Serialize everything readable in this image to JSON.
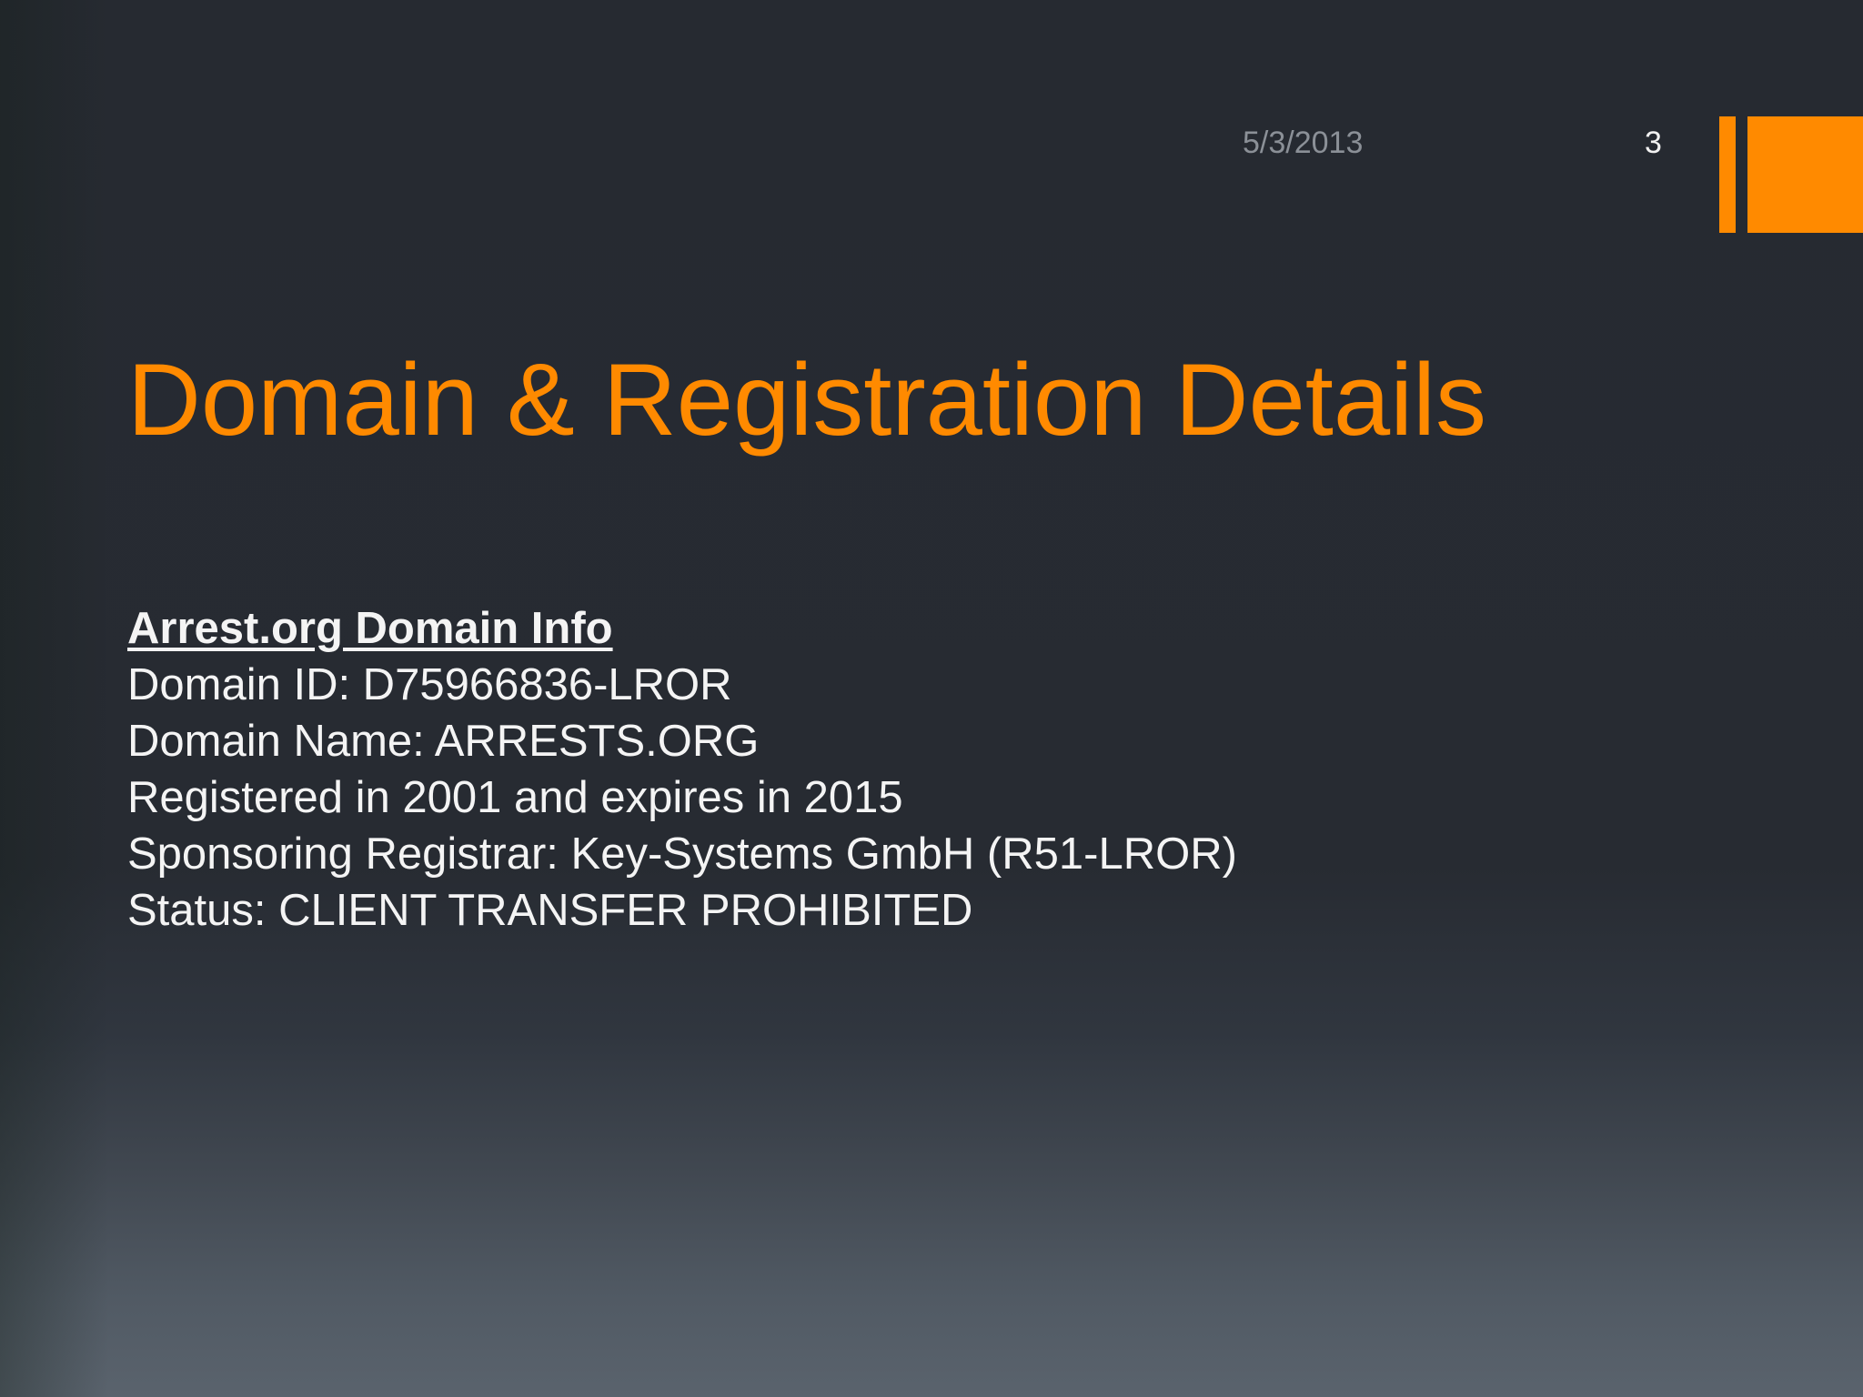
{
  "slide": {
    "date": "5/3/2013",
    "number": "3",
    "title": "Domain & Registration Details",
    "accent_color": "#ff8a00",
    "background_color": "#262a31"
  },
  "content": {
    "heading": "Arrest.org Domain Info",
    "lines": [
      "Domain ID: D75966836-LROR",
      "Domain Name: ARRESTS.ORG",
      "Registered in 2001 and expires in 2015",
      "Sponsoring Registrar: Key-Systems GmbH (R51-LROR)",
      "Status: CLIENT TRANSFER PROHIBITED"
    ]
  }
}
